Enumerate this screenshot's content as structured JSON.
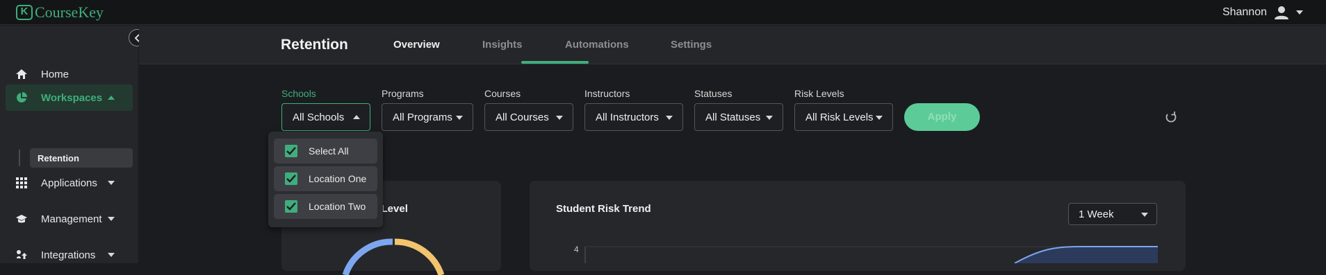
{
  "app": {
    "logo_letter": "K",
    "logo_text": "CourseKey",
    "brand_color": "#3fae7c"
  },
  "user": {
    "name": "Shannon"
  },
  "sidebar": {
    "items": [
      {
        "label": "Home",
        "icon": "home-icon"
      },
      {
        "label": "Workspaces",
        "icon": "pie-chart-icon",
        "active": true
      },
      {
        "label": "Applications",
        "icon": "grid-icon"
      },
      {
        "label": "Management",
        "icon": "graduation-cap-icon"
      },
      {
        "label": "Integrations",
        "icon": "cloud-upload-icon"
      }
    ],
    "sub_item": "Retention"
  },
  "header": {
    "title": "Retention",
    "tabs": [
      {
        "label": "Overview",
        "active": true
      },
      {
        "label": "Insights"
      },
      {
        "label": "Automations"
      },
      {
        "label": "Settings"
      }
    ]
  },
  "filters": [
    {
      "label": "Schools",
      "value": "All Schools",
      "open": true
    },
    {
      "label": "Programs",
      "value": "All Programs"
    },
    {
      "label": "Courses",
      "value": "All Courses"
    },
    {
      "label": "Instructors",
      "value": "All Instructors"
    },
    {
      "label": "Statuses",
      "value": "All Statuses"
    },
    {
      "label": "Risk Levels",
      "value": "All Risk Levels"
    }
  ],
  "apply_label": "Apply",
  "schools_dropdown": {
    "options": [
      {
        "label": "Select All",
        "checked": true
      },
      {
        "label": "Location One",
        "checked": true
      },
      {
        "label": "Location Two",
        "checked": true
      }
    ]
  },
  "cards": {
    "risk_level": {
      "title_visible": "k Level"
    },
    "risk_trend": {
      "title": "Student Risk Trend",
      "range": "1 Week",
      "y_top_tick": "4"
    }
  },
  "donut_colors": {
    "a": "#7ea6f0",
    "b": "#f2c46e"
  },
  "trend_color": "#7ea6f0"
}
